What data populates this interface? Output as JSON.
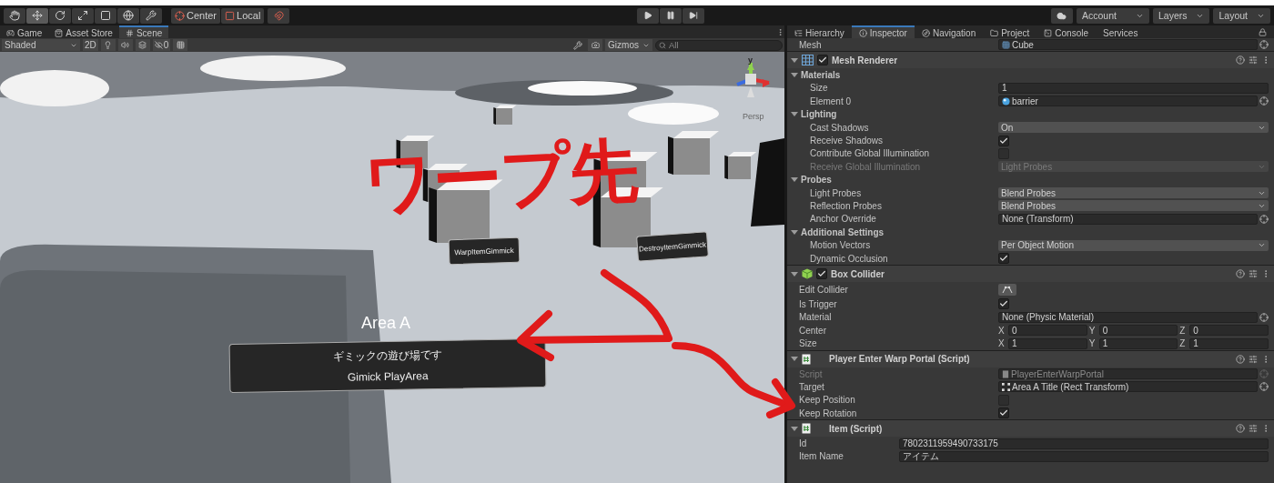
{
  "toolbar": {
    "tools": [
      {
        "kind": "hand",
        "selected": false
      },
      {
        "kind": "move",
        "selected": true
      },
      {
        "kind": "rotate",
        "selected": false
      },
      {
        "kind": "scale",
        "selected": false
      },
      {
        "kind": "rect",
        "selected": false
      },
      {
        "kind": "transform",
        "selected": false
      },
      {
        "kind": "custom",
        "selected": false
      }
    ],
    "pivot": [
      {
        "kind": "pivot",
        "label": "Center"
      },
      {
        "kind": "space",
        "label": "Local"
      }
    ],
    "play": [
      {
        "kind": "play",
        "selected": false
      },
      {
        "kind": "pause",
        "selected": false
      },
      {
        "kind": "step",
        "selected": false
      }
    ],
    "menus": [
      {
        "label": "Account"
      },
      {
        "label": "Layers"
      },
      {
        "label": "Layout"
      }
    ]
  },
  "scene_panel": {
    "tabs": [
      {
        "kind": "game",
        "label": "Game",
        "selected": false
      },
      {
        "kind": "store",
        "label": "Asset Store",
        "selected": false
      },
      {
        "kind": "scene",
        "label": "Scene",
        "selected": true
      }
    ],
    "toolbar": {
      "shading": "Shaded",
      "mode_2d": "2D",
      "hidden_count": "0",
      "gizmos": "Gizmos",
      "search": {
        "placeholder": "All"
      }
    },
    "gizmo": {
      "axis": "y",
      "projection": "Persp"
    },
    "boards": [
      {
        "text": "WarpItemGimmick"
      },
      {
        "text": "DestroyItemGimmick"
      }
    ],
    "area": {
      "title": "Area A",
      "lines": [
        "ギミックの遊び場です",
        "Gimick PlayArea"
      ]
    },
    "annotation": {
      "text": "ワープ先"
    }
  },
  "inspector": {
    "tabs": [
      {
        "kind": "hierarchy",
        "label": "Hierarchy",
        "selected": false
      },
      {
        "kind": "inspector",
        "label": "Inspector",
        "selected": true
      },
      {
        "kind": "navigation",
        "label": "Navigation",
        "selected": false
      },
      {
        "kind": "project",
        "label": "Project",
        "selected": false
      },
      {
        "kind": "console",
        "label": "Console",
        "selected": false
      },
      {
        "kind": "services",
        "label": "Services",
        "selected": false
      }
    ],
    "top_rows": [
      {
        "kind": "meshref",
        "label": "Mesh",
        "value": "Cube",
        "disabled": false
      }
    ],
    "components": [
      {
        "kind": "renderer",
        "title": "Mesh Renderer",
        "enabled": true,
        "rows": [
          {
            "kind": "section",
            "label": "Materials",
            "expanded": true,
            "children": [
              {
                "kind": "text",
                "label": "Size",
                "value": "1",
                "disabled": false
              },
              {
                "kind": "materialref",
                "label": "Element 0",
                "value": "barrier",
                "disabled": false
              }
            ]
          },
          {
            "kind": "section",
            "label": "Lighting",
            "expanded": true,
            "children": [
              {
                "kind": "dropdown",
                "label": "Cast Shadows",
                "value": "On",
                "disabled": false
              },
              {
                "kind": "checkbox",
                "label": "Receive Shadows",
                "checked": true,
                "disabled": false
              },
              {
                "kind": "checkbox",
                "label": "Contribute Global Illumination",
                "checked": false,
                "disabled": false
              },
              {
                "kind": "dropdown",
                "label": "Receive Global Illumination",
                "value": "Light Probes",
                "disabled": true
              }
            ]
          },
          {
            "kind": "section",
            "label": "Probes",
            "expanded": true,
            "children": [
              {
                "kind": "dropdown",
                "label": "Light Probes",
                "value": "Blend Probes",
                "disabled": false
              },
              {
                "kind": "dropdown",
                "label": "Reflection Probes",
                "value": "Blend Probes",
                "disabled": false
              },
              {
                "kind": "objectref",
                "label": "Anchor Override",
                "value": "None (Transform)",
                "disabled": false
              }
            ]
          },
          {
            "kind": "section",
            "label": "Additional Settings",
            "expanded": true,
            "children": [
              {
                "kind": "dropdown",
                "label": "Motion Vectors",
                "value": "Per Object Motion",
                "disabled": false
              },
              {
                "kind": "checkbox",
                "label": "Dynamic Occlusion",
                "checked": true,
                "disabled": false
              }
            ]
          }
        ]
      },
      {
        "kind": "collider",
        "title": "Box Collider",
        "enabled": true,
        "rows": [
          {
            "kind": "button",
            "label": "Edit Collider",
            "disabled": false
          },
          {
            "kind": "checkbox",
            "label": "Is Trigger",
            "checked": true,
            "disabled": false
          },
          {
            "kind": "objectref",
            "label": "Material",
            "value": "None (Physic Material)",
            "disabled": false
          },
          {
            "kind": "vector",
            "label": "Center",
            "values": [
              {
                "axis": "X",
                "value": "0"
              },
              {
                "axis": "Y",
                "value": "0"
              },
              {
                "axis": "Z",
                "value": "0"
              }
            ],
            "disabled": false
          },
          {
            "kind": "vector",
            "label": "Size",
            "values": [
              {
                "axis": "X",
                "value": "1"
              },
              {
                "axis": "Y",
                "value": "1"
              },
              {
                "axis": "Z",
                "value": "1"
              }
            ],
            "disabled": false
          }
        ]
      },
      {
        "kind": "script",
        "title": "Player Enter Warp Portal (Script)",
        "rows": [
          {
            "kind": "scriptref",
            "label": "Script",
            "value": "PlayerEnterWarpPortal",
            "disabled": true
          },
          {
            "kind": "rectref",
            "label": "Target",
            "value": "Area A Title (Rect Transform)",
            "disabled": false
          },
          {
            "kind": "checkbox",
            "label": "Keep Position",
            "checked": false,
            "disabled": false
          },
          {
            "kind": "checkbox",
            "label": "Keep Rotation",
            "checked": true,
            "disabled": false
          }
        ]
      },
      {
        "kind": "script",
        "title": "Item (Script)",
        "rows": [
          {
            "kind": "longtext",
            "label": "Id",
            "value": "7802311959490733175",
            "disabled": false
          },
          {
            "kind": "longtext",
            "label": "Item Name",
            "value": "アイテム",
            "disabled": false
          }
        ]
      }
    ]
  }
}
